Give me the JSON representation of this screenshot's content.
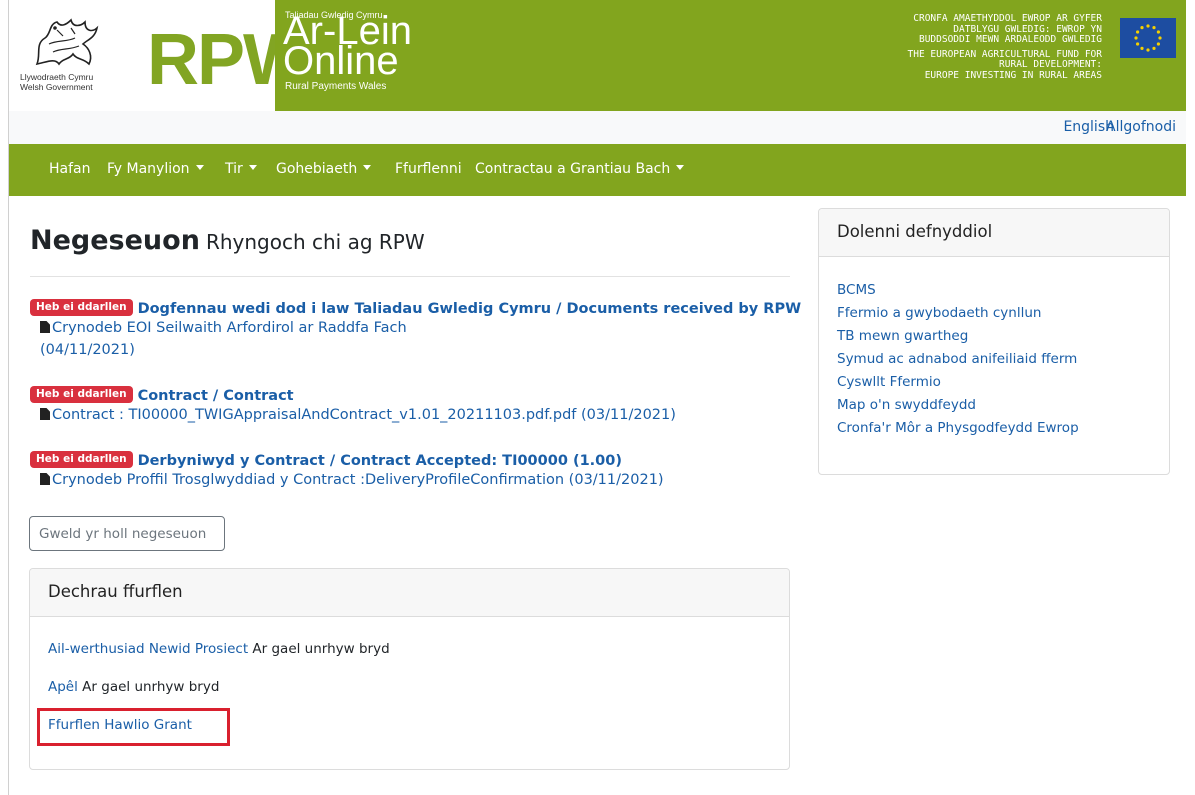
{
  "header": {
    "gov_name_cy": "Llywodraeth Cymru",
    "gov_name_en": "Welsh Government",
    "rpw_letters": "RPW",
    "band_small": "Taliadau Gwledig Cymru",
    "band_line1": "Ar-Lein",
    "band_line2": "Online",
    "band_sub": "Rural Payments Wales",
    "eu_lines": [
      "CRONFA AMAETHYDDOL EWROP AR GYFER",
      "DATBLYGU GWLEDIG: EWROP YN",
      "BUDDSODDI MEWN ARDALEODD GWLEDIG",
      "THE EUROPEAN AGRICULTURAL FUND FOR",
      "RURAL DEVELOPMENT:",
      "EUROPE INVESTING IN RURAL AREAS"
    ]
  },
  "toplinks": {
    "english": "English",
    "logout": "Allgofnodi"
  },
  "nav": {
    "items": [
      "Hafan",
      "Fy Manylion",
      "Tir",
      "Gohebiaeth",
      "Ffurflenni",
      "Contractau a Grantiau Bach"
    ]
  },
  "page": {
    "title": "Negeseuon",
    "subtitle": "Rhyngoch chi ag RPW"
  },
  "messages": [
    {
      "badge": "Heb ei ddarllen",
      "title": "Dogfennau wedi dod i law Taliadau Gwledig Cymru / Documents received by RPW",
      "line": "Crynodeb EOI Seilwaith Arfordirol ar Raddfa Fach",
      "date": "(04/11/2021)"
    },
    {
      "badge": "Heb ei ddarllen",
      "title": "Contract / Contract",
      "line": "Contract : TI00000_TWIGAppraisalAndContract_v1.01_20211103.pdf.pdf (03/11/2021)"
    },
    {
      "badge": "Heb ei ddarllen",
      "title": "Derbyniwyd y Contract / Contract Accepted: TI00000 (1.00)",
      "line": "Crynodeb Proffil Trosglwyddiad y Contract :DeliveryProfileConfirmation (03/11/2021)"
    }
  ],
  "view_all_button": "Gweld yr holl negeseuon",
  "start_form": {
    "heading": "Dechrau ffurflen",
    "items": [
      {
        "link": "Ail-werthusiad Newid Prosiect",
        "note": "Ar gael unrhyw bryd"
      },
      {
        "link": "Apêl",
        "note": "Ar gael unrhyw bryd"
      },
      {
        "link": "Ffurflen Hawlio Grant",
        "note": ""
      }
    ]
  },
  "useful_links": {
    "heading": "Dolenni defnyddiol",
    "items": [
      "BCMS",
      "Ffermio a gwybodaeth cynllun",
      "TB mewn gwartheg",
      "Symud ac adnabod anifeiliaid fferm",
      "Cyswllt Ffermio",
      "Map o'n swyddfeydd",
      "Cronfa'r Môr a Physgodfeydd Ewrop"
    ]
  },
  "colors": {
    "brand_green": "#82a51e",
    "link_blue": "#1a5ea7",
    "badge_red": "#d9303e",
    "highlight_red": "#d9202e"
  },
  "icons": {
    "document": "file-icon",
    "eu_flag": "eu-flag-icon",
    "dragon": "welsh-dragon-logo"
  }
}
